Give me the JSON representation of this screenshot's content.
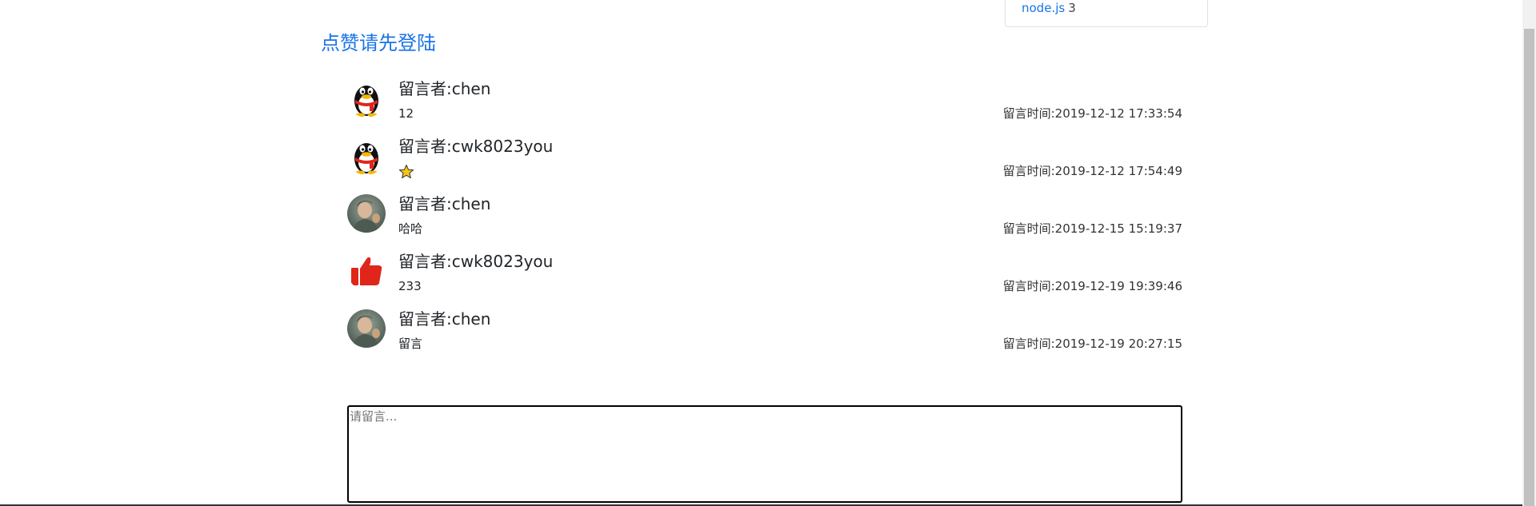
{
  "sidebar_tags": {
    "item": {
      "label": "node.js",
      "count": "3"
    }
  },
  "login_prompt": "点赞请先登陆",
  "comments": [
    {
      "author": "留言者:chen",
      "content": "12",
      "time": "留言时间:2019-12-12 17:33:54",
      "avatar": "qq-penguin-icon"
    },
    {
      "author": "留言者:cwk8023you",
      "content": "",
      "content_icon": "star-icon",
      "time": "留言时间:2019-12-12 17:54:49",
      "avatar": "qq-penguin-icon"
    },
    {
      "author": "留言者:chen",
      "content": "哈哈",
      "time": "留言时间:2019-12-15 15:19:37",
      "avatar": "user-photo-avatar"
    },
    {
      "author": "留言者:cwk8023you",
      "content": "233",
      "time": "留言时间:2019-12-19 19:39:46",
      "avatar": "thumbs-up-icon"
    },
    {
      "author": "留言者:chen",
      "content": "留言",
      "time": "留言时间:2019-12-19 20:27:15",
      "avatar": "user-photo-avatar"
    }
  ],
  "comment_input": {
    "placeholder": "请留言...",
    "value": ""
  },
  "colors": {
    "link": "#1a73e8",
    "text": "#212529",
    "star": "#f5c518",
    "thumbs_up": "#e0251b"
  }
}
